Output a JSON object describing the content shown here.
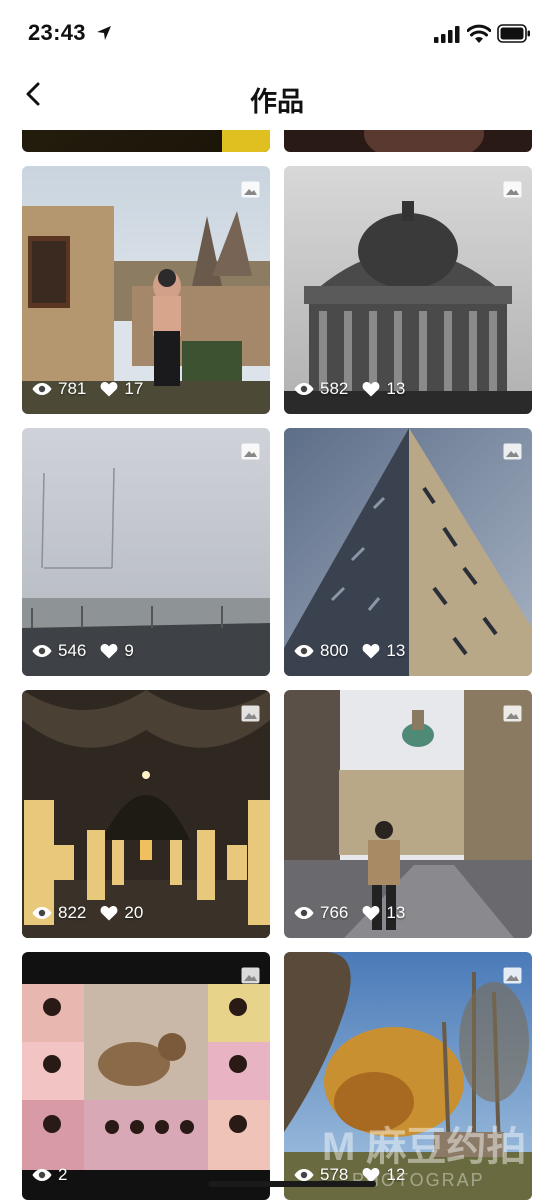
{
  "status_bar": {
    "time": "23:43",
    "icons": [
      "location-arrow-icon",
      "signal-icon",
      "wifi-icon",
      "battery-icon"
    ]
  },
  "nav": {
    "title": "作品",
    "back_icon": "chevron-left-icon"
  },
  "posts": [
    {
      "views": "",
      "likes": ""
    },
    {
      "views": "",
      "likes": ""
    },
    {
      "views": "781",
      "likes": "17"
    },
    {
      "views": "582",
      "likes": "13"
    },
    {
      "views": "546",
      "likes": "9"
    },
    {
      "views": "800",
      "likes": "13"
    },
    {
      "views": "822",
      "likes": "20"
    },
    {
      "views": "766",
      "likes": "13"
    },
    {
      "views": "2",
      "likes": ""
    },
    {
      "views": "578",
      "likes": "12"
    }
  ],
  "watermark": {
    "logo": "M 麻豆约拍",
    "sub": "PHOTOGRAP"
  },
  "colors": {
    "background": "#ffffff",
    "text": "#111111",
    "overlay_text": "#ffffff"
  }
}
